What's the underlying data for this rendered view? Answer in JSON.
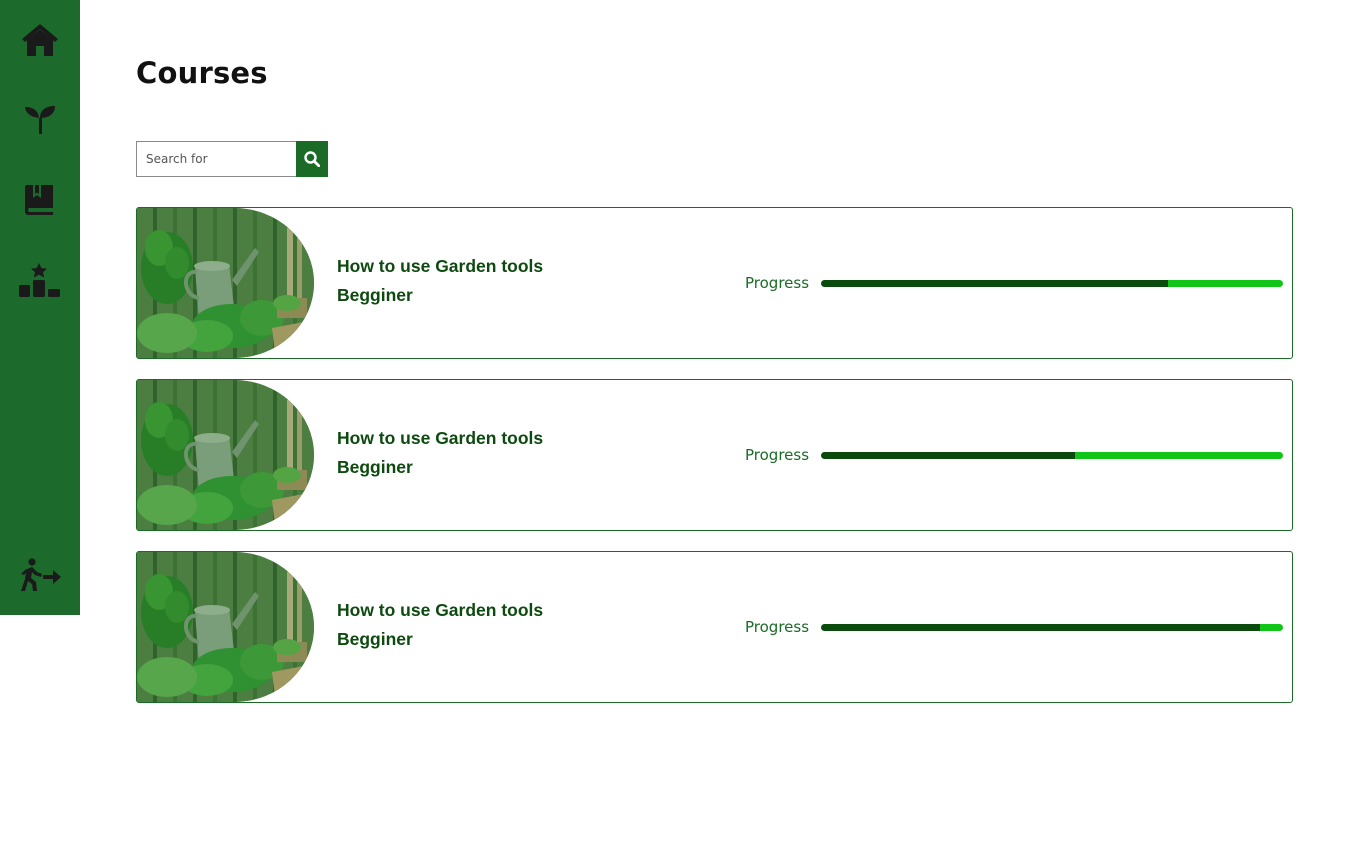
{
  "sidebar": {
    "items": [
      {
        "icon": "home-icon"
      },
      {
        "icon": "seedling-icon"
      },
      {
        "icon": "book-bookmark-icon"
      },
      {
        "icon": "ranking-podium-icon"
      }
    ],
    "logout": {
      "icon": "exit-running-icon"
    },
    "background": "#1c6b2c",
    "icon_color": "#1a1a1a"
  },
  "main": {
    "title": "Courses",
    "search": {
      "placeholder": "Search for",
      "value": "",
      "button_icon": "search-icon"
    },
    "courses": [
      {
        "title_line1": "How to use Garden tools",
        "title_line2": "Begginer",
        "progress_label": "Progress",
        "progress": 0.75
      },
      {
        "title_line1": "How to use Garden tools",
        "title_line2": "Begginer",
        "progress_label": "Progress",
        "progress": 0.55
      },
      {
        "title_line1": "How to use Garden tools",
        "title_line2": "Begginer",
        "progress_label": "Progress",
        "progress": 0.95
      }
    ]
  },
  "colors": {
    "accent": "#1a6b26",
    "title_text": "#0d4a10",
    "progress_done": "#0b4a0d",
    "progress_remaining": "#11c418"
  }
}
